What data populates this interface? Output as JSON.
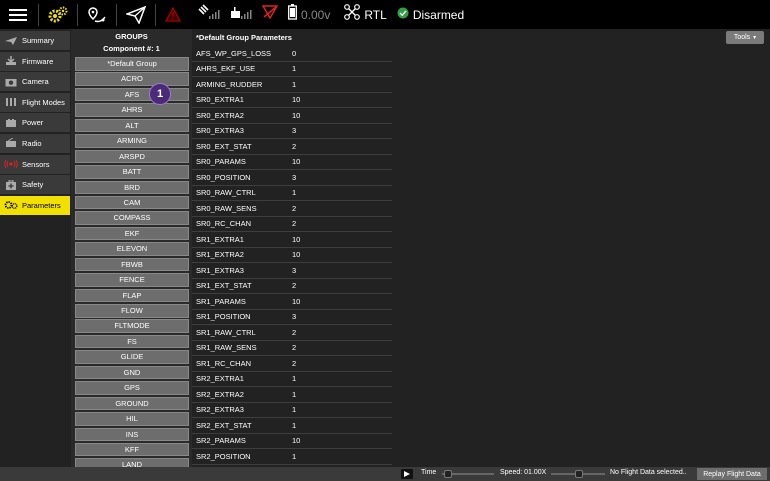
{
  "toolbar": {
    "battery_voltage": "0.00v",
    "flight_mode": "RTL",
    "arm_status": "Disarmed",
    "accent_yellow": "#f2e000",
    "icons": [
      "menu-icon",
      "settings-gear-icon",
      "plan-route-icon",
      "fly-paper-plane-icon",
      "warning-icon",
      "gps-satellite-icon",
      "rc-signal-icon",
      "telemetry-icon",
      "battery-icon",
      "drone-icon",
      "ok-check-icon"
    ]
  },
  "nav": {
    "items": [
      {
        "label": "Summary",
        "icon": "plane-icon"
      },
      {
        "label": "Firmware",
        "icon": "download-icon"
      },
      {
        "label": "Camera",
        "icon": "camera-icon"
      },
      {
        "label": "Flight Modes",
        "icon": "switches-icon"
      },
      {
        "label": "Power",
        "icon": "power-icon"
      },
      {
        "label": "Radio",
        "icon": "radio-icon"
      },
      {
        "label": "Sensors",
        "icon": "sensors-icon"
      },
      {
        "label": "Safety",
        "icon": "safety-icon"
      },
      {
        "label": "Parameters",
        "icon": "gears-icon"
      }
    ],
    "active": "Parameters"
  },
  "groups": {
    "title": "GROUPS",
    "component": "Component #: 1",
    "items": [
      "*Default Group",
      "ACRO",
      "AFS",
      "AHRS",
      "ALT",
      "ARMING",
      "ARSPD",
      "BATT",
      "BRD",
      "CAM",
      "COMPASS",
      "EKF",
      "ELEVON",
      "FBWB",
      "FENCE",
      "FLAP",
      "FLOW",
      "FLTMODE",
      "FS",
      "GLIDE",
      "GND",
      "GPS",
      "GROUND",
      "HIL",
      "INS",
      "KFF",
      "LAND"
    ]
  },
  "params": {
    "title": "*Default Group Parameters",
    "tools_label": "Tools",
    "rows": [
      {
        "name": "AFS_WP_GPS_LOSS",
        "value": "0"
      },
      {
        "name": "AHRS_EKF_USE",
        "value": "1"
      },
      {
        "name": "ARMING_RUDDER",
        "value": "1"
      },
      {
        "name": "SR0_EXTRA1",
        "value": "10"
      },
      {
        "name": "SR0_EXTRA2",
        "value": "10"
      },
      {
        "name": "SR0_EXTRA3",
        "value": "3"
      },
      {
        "name": "SR0_EXT_STAT",
        "value": "2"
      },
      {
        "name": "SR0_PARAMS",
        "value": "10"
      },
      {
        "name": "SR0_POSITION",
        "value": "3"
      },
      {
        "name": "SR0_RAW_CTRL",
        "value": "1"
      },
      {
        "name": "SR0_RAW_SENS",
        "value": "2"
      },
      {
        "name": "SR0_RC_CHAN",
        "value": "2"
      },
      {
        "name": "SR1_EXTRA1",
        "value": "10"
      },
      {
        "name": "SR1_EXTRA2",
        "value": "10"
      },
      {
        "name": "SR1_EXTRA3",
        "value": "3"
      },
      {
        "name": "SR1_EXT_STAT",
        "value": "2"
      },
      {
        "name": "SR1_PARAMS",
        "value": "10"
      },
      {
        "name": "SR1_POSITION",
        "value": "3"
      },
      {
        "name": "SR1_RAW_CTRL",
        "value": "2"
      },
      {
        "name": "SR1_RAW_SENS",
        "value": "2"
      },
      {
        "name": "SR1_RC_CHAN",
        "value": "2"
      },
      {
        "name": "SR2_EXTRA1",
        "value": "1"
      },
      {
        "name": "SR2_EXTRA2",
        "value": "1"
      },
      {
        "name": "SR2_EXTRA3",
        "value": "1"
      },
      {
        "name": "SR2_EXT_STAT",
        "value": "1"
      },
      {
        "name": "SR2_PARAMS",
        "value": "10"
      },
      {
        "name": "SR2_POSITION",
        "value": "1"
      }
    ]
  },
  "bottom": {
    "time_label": "Time",
    "speed_label": "Speed: 01.00X",
    "status": "No Flight Data selected..",
    "replay_label": "Replay Flight Data"
  },
  "badge": {
    "number": "1"
  }
}
